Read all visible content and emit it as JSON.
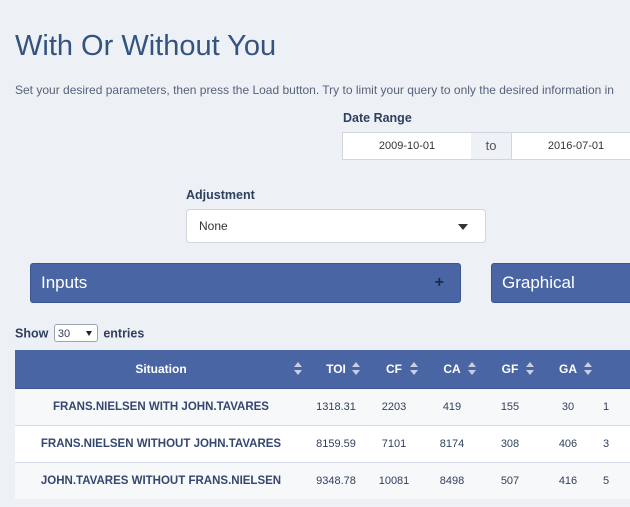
{
  "page": {
    "title": "With Or Without You",
    "intro": "Set your desired parameters, then press the Load button. Try to limit your query to only the desired information in"
  },
  "date_range": {
    "label": "Date Range",
    "start": "2009-10-01",
    "separator": "to",
    "end": "2016-07-01"
  },
  "adjustment": {
    "label": "Adjustment",
    "selected": "None"
  },
  "panels": {
    "inputs": "Inputs",
    "inputs_toggle": "+",
    "graphical": "Graphical"
  },
  "table_controls": {
    "show": "Show",
    "entries_value": "30",
    "entries": "entries"
  },
  "table": {
    "headers": [
      "Situation",
      "TOI",
      "CF",
      "CA",
      "GF",
      "GA",
      ""
    ],
    "rows": [
      [
        "FRANS.NIELSEN WITH JOHN.TAVARES",
        "1318.31",
        "2203",
        "419",
        "155",
        "30",
        "1"
      ],
      [
        "FRANS.NIELSEN WITHOUT JOHN.TAVARES",
        "8159.59",
        "7101",
        "8174",
        "308",
        "406",
        "3"
      ],
      [
        "JOHN.TAVARES WITHOUT FRANS.NIELSEN",
        "9348.78",
        "10081",
        "8498",
        "507",
        "416",
        "5"
      ]
    ]
  }
}
